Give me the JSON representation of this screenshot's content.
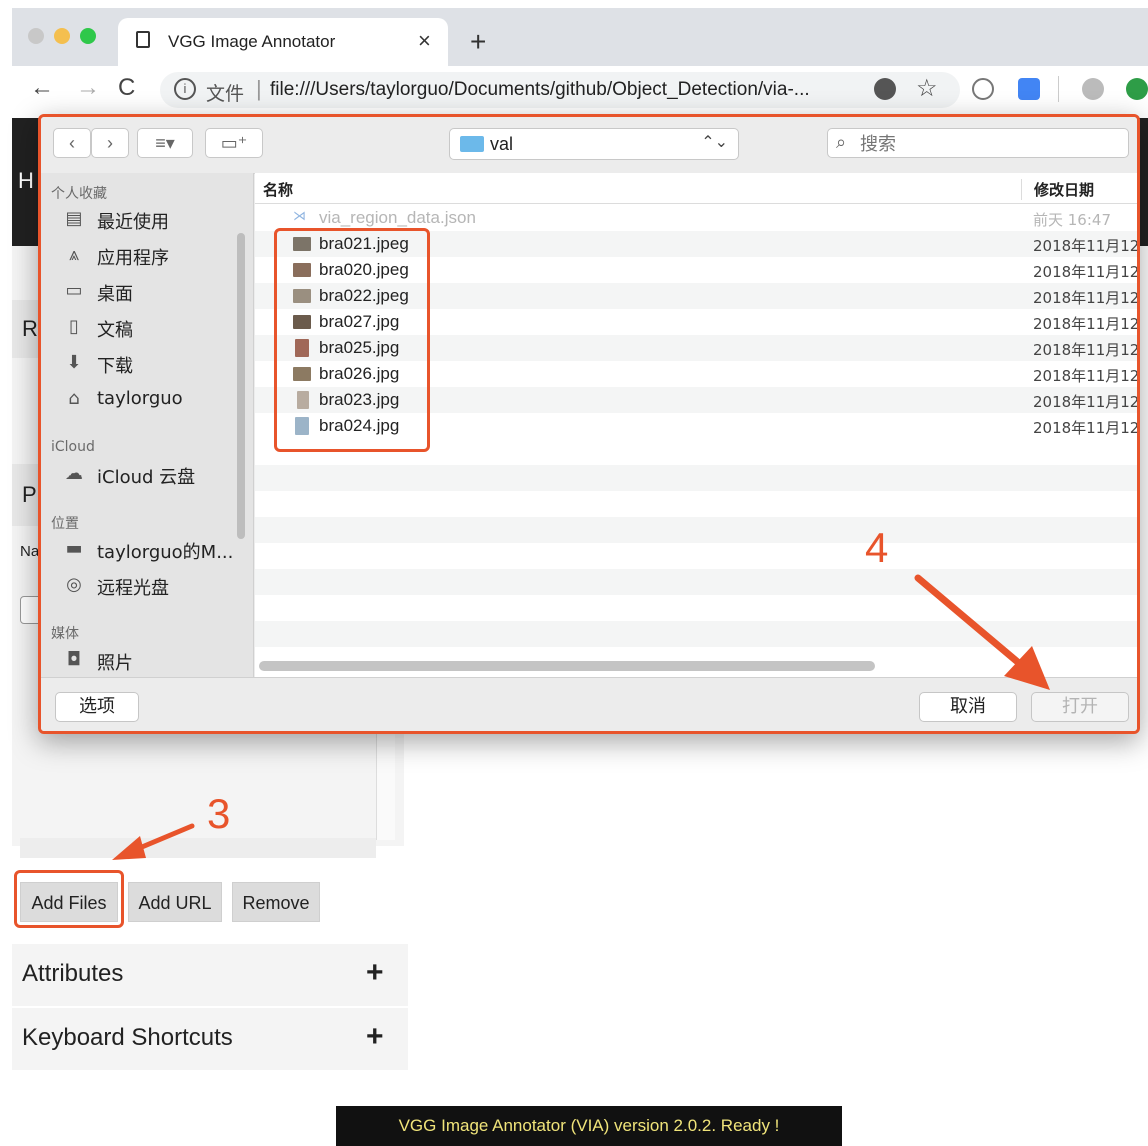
{
  "browser": {
    "tab_title": "VGG Image Annotator",
    "tab_close": "×",
    "new_tab": "+",
    "back": "←",
    "forward": "→",
    "reload": "C",
    "info": "i",
    "scheme_label": "文件",
    "url": "file:///Users/taylorguo/Documents/github/Object_Detection/via-..."
  },
  "via": {
    "add_files": "Add Files",
    "add_url": "Add URL",
    "remove": "Remove",
    "attributes": "Attributes",
    "keyboard_shortcuts": "Keyboard Shortcuts",
    "accordion_plus": "+",
    "status": "VGG Image Annotator (VIA) version 2.0.2. Ready !",
    "partial_letters": [
      "H",
      "R",
      "P",
      "Na"
    ]
  },
  "dialog": {
    "location": "val",
    "search_placeholder": "搜索",
    "sidebar": {
      "favorites_header": "个人收藏",
      "favorites": [
        {
          "label": "最近使用",
          "icon": "recents-icon"
        },
        {
          "label": "应用程序",
          "icon": "applications-icon"
        },
        {
          "label": "桌面",
          "icon": "desktop-icon"
        },
        {
          "label": "文稿",
          "icon": "documents-icon"
        },
        {
          "label": "下载",
          "icon": "downloads-icon"
        },
        {
          "label": "taylorguo",
          "icon": "home-icon"
        }
      ],
      "icloud_header": "iCloud",
      "icloud": [
        {
          "label": "iCloud 云盘",
          "icon": "cloud-icon"
        }
      ],
      "locations_header": "位置",
      "locations": [
        {
          "label": "taylorguo的M...",
          "icon": "laptop-icon"
        },
        {
          "label": "远程光盘",
          "icon": "disc-icon"
        }
      ],
      "media_header": "媒体",
      "media": [
        {
          "label": "照片",
          "icon": "camera-icon"
        }
      ]
    },
    "columns": {
      "name": "名称",
      "modified": "修改日期"
    },
    "files": [
      {
        "name": "via_region_data.json",
        "date": "前天 16:47",
        "enabled": false
      },
      {
        "name": "bra021.jpeg",
        "date": "2018年11月12",
        "enabled": true
      },
      {
        "name": "bra020.jpeg",
        "date": "2018年11月12",
        "enabled": true
      },
      {
        "name": "bra022.jpeg",
        "date": "2018年11月12",
        "enabled": true
      },
      {
        "name": "bra027.jpg",
        "date": "2018年11月12",
        "enabled": true
      },
      {
        "name": "bra025.jpg",
        "date": "2018年11月12",
        "enabled": true
      },
      {
        "name": "bra026.jpg",
        "date": "2018年11月12",
        "enabled": true
      },
      {
        "name": "bra023.jpg",
        "date": "2018年11月12",
        "enabled": true
      },
      {
        "name": "bra024.jpg",
        "date": "2018年11月12",
        "enabled": true
      }
    ],
    "options_button": "选项",
    "cancel_button": "取消",
    "open_button": "打开"
  },
  "annotations": {
    "step_3": "3",
    "step_4": "4"
  },
  "colors": {
    "highlight": "#e8542b",
    "status_text": "#f0e47a",
    "folder": "#6cb9ea"
  }
}
